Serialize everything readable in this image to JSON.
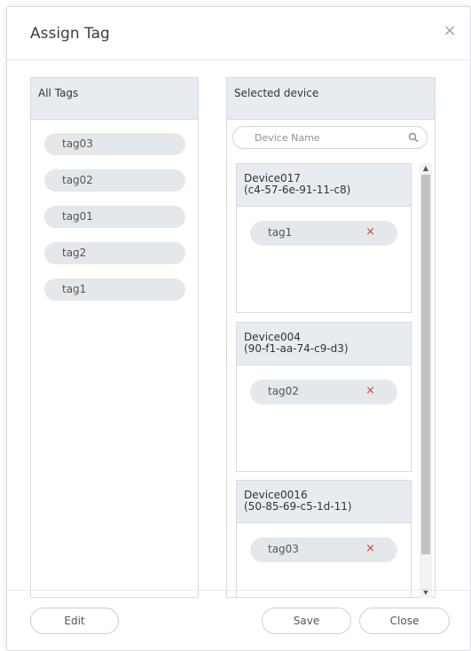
{
  "dialog": {
    "title": "Assign Tag",
    "close_icon": "close-icon"
  },
  "all_tags": {
    "header": "All Tags",
    "items": [
      "tag03",
      "tag02",
      "tag01",
      "tag2",
      "tag1"
    ]
  },
  "selected": {
    "header": "Selected device",
    "search": {
      "placeholder": "Device Name",
      "value": "",
      "icon": "search-icon"
    },
    "devices": [
      {
        "name": "Device017",
        "mac": "(c4-57-6e-91-11-c8)",
        "tags": [
          "tag1"
        ]
      },
      {
        "name": "Device004",
        "mac": "(90-f1-aa-74-c9-d3)",
        "tags": [
          "tag02"
        ]
      },
      {
        "name": "Device0016",
        "mac": "(50-85-69-c5-1d-11)",
        "tags": [
          "tag03"
        ]
      }
    ],
    "remove_symbol": "×"
  },
  "footer": {
    "edit_label": "Edit",
    "save_label": "Save",
    "close_label": "Close"
  },
  "colors": {
    "panel_header_bg": "#e8ecf0",
    "pill_bg": "#e5e8eb",
    "remove_red": "#e03b3b",
    "border": "#d5dbe1"
  }
}
